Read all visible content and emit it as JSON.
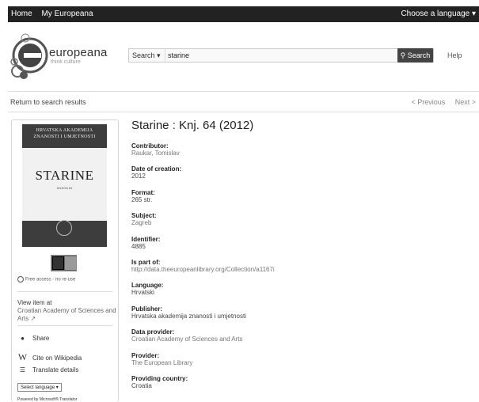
{
  "topbar": {
    "home": "Home",
    "my_europeana": "My Europeana",
    "language": "Choose a language ▾"
  },
  "logo": {
    "name": "europeana",
    "tagline": "think culture"
  },
  "search": {
    "scope": "Search ▾",
    "query": "starine",
    "button": "Search",
    "help": "Help"
  },
  "navigation": {
    "back": "Return to search results",
    "previous": "< Previous",
    "next": "Next >"
  },
  "cover": {
    "header_line1": "HRVATSKA AKADEMIJA",
    "header_line2": "ZNANOSTI I UMJETNOSTI",
    "title": "STARINE",
    "subtitle": "KNJIGA 64"
  },
  "side": {
    "access": "Free access - no re-use",
    "view_item_at": "View item at",
    "provider_link": "Croatian Academy of Sciences and Arts",
    "share": "Share",
    "cite": "Cite on Wikipedia",
    "translate": "Translate details",
    "select_language": "Select language ▾",
    "powered_by": "Powered by Microsoft® Translator"
  },
  "record": {
    "title": "Starine : Knj. 64 (2012)",
    "fields": [
      {
        "label": "Contributor:",
        "value": "Raukar, Tomislav"
      },
      {
        "label": "Date of creation:",
        "value": "2012"
      },
      {
        "label": "Format:",
        "value": "265 str."
      },
      {
        "label": "Subject:",
        "value": "Zagreb"
      },
      {
        "label": "Identifier:",
        "value": "4885"
      },
      {
        "label": "Is part of:",
        "value": "http://data.theeuropeanlibrary.org/Collection/a1167i"
      },
      {
        "label": "Language:",
        "value": "Hrvatski"
      },
      {
        "label": "Publisher:",
        "value": "Hrvatska akademija znanosti i umjetnosti"
      },
      {
        "label": "Data provider:",
        "value": "Croatian Academy of Sciences and Arts"
      },
      {
        "label": "Provider:",
        "value": "The European Library"
      },
      {
        "label": "Providing country:",
        "value": "Croatia"
      }
    ]
  }
}
